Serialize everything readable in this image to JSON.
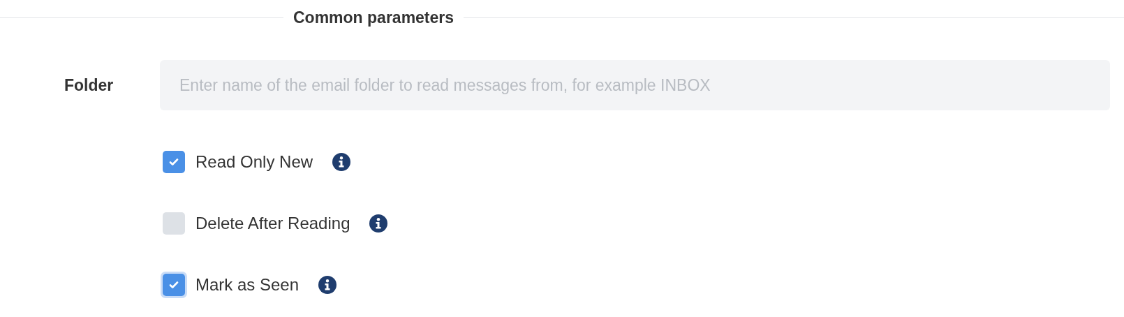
{
  "section": {
    "title": "Common parameters"
  },
  "folder": {
    "label": "Folder",
    "placeholder": "Enter name of the email folder to read messages from, for example INBOX"
  },
  "options": [
    {
      "label": "Read Only New",
      "checked": true,
      "focused": false
    },
    {
      "label": "Delete After Reading",
      "checked": false,
      "focused": false
    },
    {
      "label": "Mark as Seen",
      "checked": true,
      "focused": true
    }
  ]
}
